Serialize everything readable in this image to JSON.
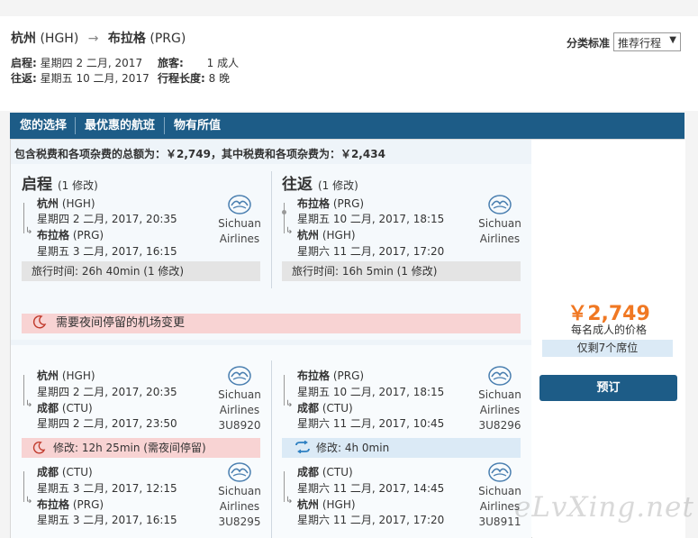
{
  "header": {
    "origin_city": "杭州",
    "origin_code": "(HGH)",
    "dest_city": "布拉格",
    "dest_code": "(PRG)",
    "depart_label": "启程:",
    "depart_value": "星期四 2 二月, 2017",
    "return_label": "往返:",
    "return_value": "星期五 10 二月, 2017",
    "travelers_label": "旅客:",
    "travelers_value": "1 成人",
    "length_label": "行程长度:",
    "length_value": "8 晚"
  },
  "sort": {
    "label": "分类标准",
    "selected": "推荐行程"
  },
  "tabs": [
    {
      "label": "您的选择"
    },
    {
      "label": "最优惠的航班"
    },
    {
      "label": "物有所值"
    }
  ],
  "result": {
    "total_line": "包含税费和各项杂费的总额为：￥2,749，其中税费和各项杂费为：￥2,434",
    "outbound": {
      "title": "启程",
      "changes": "(1 修改)",
      "from_city": "杭州",
      "from_code": "(HGH)",
      "from_time": "星期四 2 二月, 2017, 20:35",
      "to_city": "布拉格",
      "to_code": "(PRG)",
      "to_time": "星期五 3 二月, 2017, 16:15",
      "airline_line1": "Sichuan",
      "airline_line2": "Airlines",
      "duration_label": "旅行时间:",
      "duration_value": "26h 40min (1 修改)"
    },
    "inbound": {
      "title": "往返",
      "changes": "(1 修改)",
      "from_city": "布拉格",
      "from_code": "(PRG)",
      "from_time": "星期五 10 二月, 2017, 18:15",
      "to_city": "杭州",
      "to_code": "(HGH)",
      "to_time": "星期六 11 二月, 2017, 17:20",
      "airline_line1": "Sichuan",
      "airline_line2": "Airlines",
      "duration_label": "旅行时间:",
      "duration_value": "16h 5min (1 修改)"
    },
    "warning": "需要夜间停留的机场变更",
    "detail": {
      "out_seg1": {
        "from_city": "杭州",
        "from_code": "(HGH)",
        "from_time": "星期四 2 二月, 2017, 20:35",
        "to_city": "成都",
        "to_code": "(CTU)",
        "to_time": "星期四 2 二月, 2017, 23:50",
        "airline_line1": "Sichuan",
        "airline_line2": "Airlines",
        "flight": "3U8920"
      },
      "out_layover": "修改: 12h 25min (需夜间停留)",
      "out_seg2": {
        "from_city": "成都",
        "from_code": "(CTU)",
        "from_time": "星期五 3 二月, 2017, 12:15",
        "to_city": "布拉格",
        "to_code": "(PRG)",
        "to_time": "星期五 3 二月, 2017, 16:15",
        "airline_line1": "Sichuan",
        "airline_line2": "Airlines",
        "flight": "3U8295"
      },
      "in_seg1": {
        "from_city": "布拉格",
        "from_code": "(PRG)",
        "from_time": "星期五 10 二月, 2017, 18:15",
        "to_city": "成都",
        "to_code": "(CTU)",
        "to_time": "星期六 11 二月, 2017, 10:45",
        "airline_line1": "Sichuan",
        "airline_line2": "Airlines",
        "flight": "3U8296"
      },
      "in_layover": "修改: 4h 0min",
      "in_seg2": {
        "from_city": "成都",
        "from_code": "(CTU)",
        "from_time": "星期六 11 二月, 2017, 14:45",
        "to_city": "杭州",
        "to_code": "(HGH)",
        "to_time": "星期六 11 二月, 2017, 17:20",
        "airline_line1": "Sichuan",
        "airline_line2": "Airlines",
        "flight": "3U8911"
      }
    },
    "price": "￥2,749",
    "price_sub": "每名成人的价格",
    "seats_left": "仅剩7个席位",
    "book_label": "预订"
  },
  "watermark": "eLvXing.net",
  "colors": {
    "accent": "#1d5c87",
    "price": "#f07823",
    "warning_bg": "#f8d3d3",
    "info_bg": "#dbeaf6"
  }
}
